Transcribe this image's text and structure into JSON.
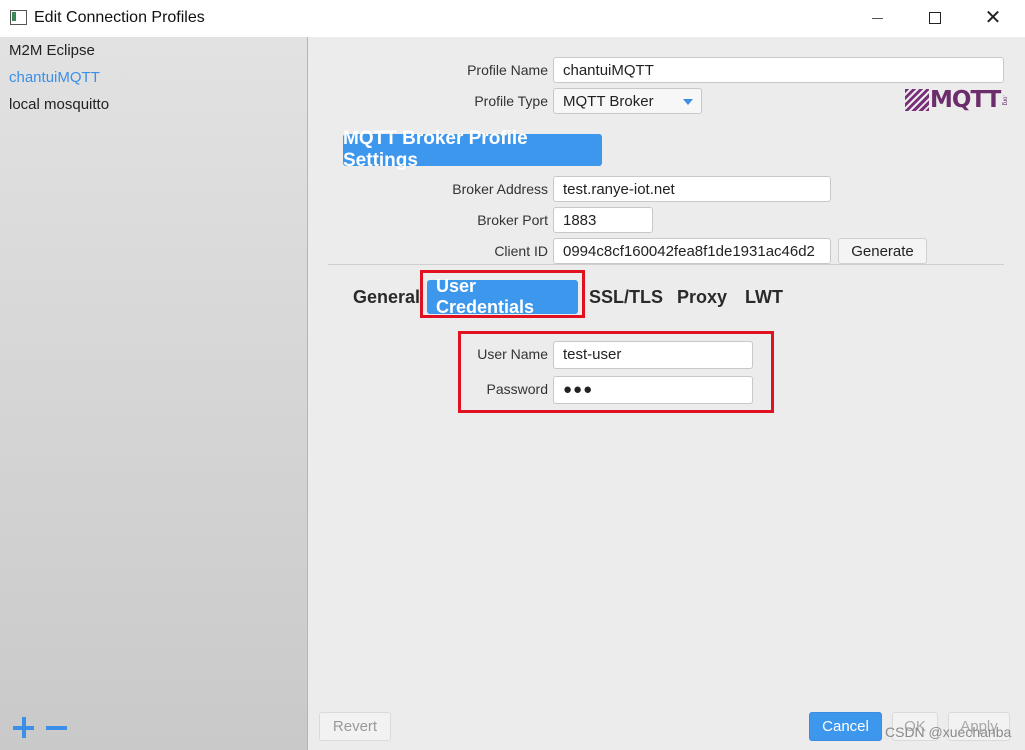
{
  "window": {
    "title": "Edit Connection Profiles"
  },
  "sidebar": {
    "profiles": [
      {
        "label": "M2M Eclipse"
      },
      {
        "label": "chantuiMQTT"
      },
      {
        "label": "local mosquitto"
      }
    ]
  },
  "profile": {
    "name_label": "Profile Name",
    "name_value": "chantuiMQTT",
    "type_label": "Profile Type",
    "type_value": "MQTT Broker"
  },
  "logo": {
    "text": "MQTT",
    "org": ".org"
  },
  "broker": {
    "section_title": "MQTT Broker Profile Settings",
    "address_label": "Broker Address",
    "address_value": "test.ranye-iot.net",
    "port_label": "Broker Port",
    "port_value": "1883",
    "client_id_label": "Client ID",
    "client_id_value": "0994c8cf160042fea8f1de1931ac46d2",
    "generate_label": "Generate"
  },
  "tabs": [
    {
      "label": "General"
    },
    {
      "label": "User Credentials"
    },
    {
      "label": "SSL/TLS"
    },
    {
      "label": "Proxy"
    },
    {
      "label": "LWT"
    }
  ],
  "credentials": {
    "username_label": "User Name",
    "username_value": "test-user",
    "password_label": "Password",
    "password_value": "●●●"
  },
  "footer": {
    "revert": "Revert",
    "cancel": "Cancel",
    "ok": "OK",
    "apply": "Apply"
  },
  "watermark": "CSDN @xuechanba",
  "colors": {
    "accent": "#3d97ed",
    "highlight_box": "#e0121f",
    "active_profile": "#3a8fe8"
  }
}
